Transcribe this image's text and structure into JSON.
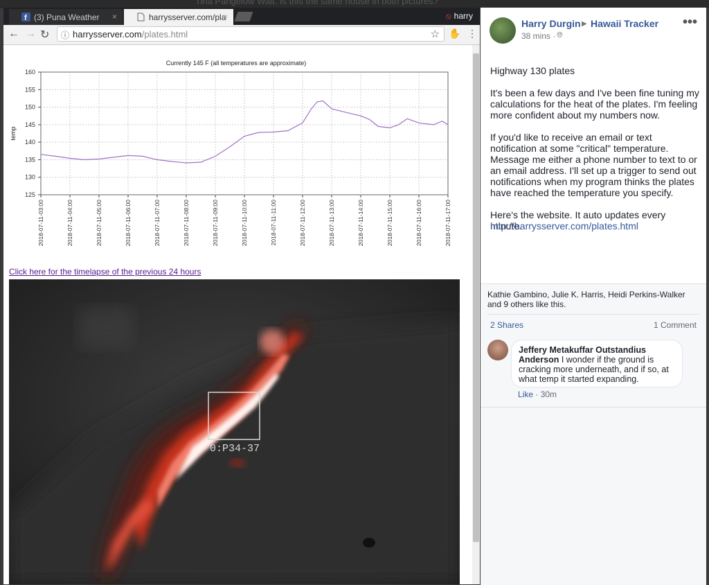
{
  "behind_text": "Tina Pangelow Wait. Is this the same house in both pictures?",
  "browser": {
    "tabs": [
      {
        "label": "(3) Puna Weather",
        "close": "×"
      },
      {
        "label": "harrysserver.com/pla",
        "close": "×"
      }
    ],
    "profile_name": "harry",
    "url_host": "harrysserver.com",
    "url_path": "/plates.html"
  },
  "page": {
    "timelapse_link": "Click here for the timelapse of the previous 24 hours"
  },
  "chart_data": {
    "type": "line",
    "title": "Currently 145 F (all temperatures are approximate)",
    "ylabel": "temp",
    "xlabel": "",
    "ylim": [
      125,
      160
    ],
    "yticks": [
      125,
      130,
      135,
      140,
      145,
      150,
      155,
      160
    ],
    "xticks": [
      "2018-07-11-03:00",
      "2018-07-11-04:00",
      "2018-07-11-05:00",
      "2018-07-11-06:00",
      "2018-07-11-07:00",
      "2018-07-11-08:00",
      "2018-07-11-09:00",
      "2018-07-11-10:00",
      "2018-07-11-11:00",
      "2018-07-11-12:00",
      "2018-07-11-13:00",
      "2018-07-11-14:00",
      "2018-07-11-15:00",
      "2018-07-11-16:00",
      "2018-07-11-17:00"
    ],
    "x_start_hour": 3,
    "x_end_hour": 17,
    "grid": true,
    "color": "#a070c8",
    "series": [
      {
        "x": [
          3.0,
          3.5,
          4.0,
          4.5,
          5.0,
          5.5,
          6.0,
          6.5,
          7.0,
          7.5,
          8.0,
          8.5,
          9.0,
          9.5,
          10.0,
          10.5,
          11.0,
          11.5,
          12.0,
          12.3,
          12.5,
          12.7,
          13.0,
          13.5,
          14.0,
          14.3,
          14.6,
          15.0,
          15.3,
          15.6,
          16.0,
          16.5,
          16.8,
          17.0
        ],
        "y": [
          136.5,
          136.0,
          135.4,
          135.0,
          135.2,
          135.7,
          136.2,
          136.0,
          135.0,
          134.5,
          134.1,
          134.3,
          136.0,
          138.7,
          141.7,
          142.8,
          142.9,
          143.3,
          145.5,
          149.5,
          151.5,
          151.8,
          149.5,
          148.5,
          147.5,
          146.5,
          144.5,
          144.1,
          145.0,
          146.7,
          145.5,
          145.0,
          146.0,
          145.0
        ]
      }
    ]
  },
  "thermal": {
    "label": "0:P34-37"
  },
  "facebook": {
    "author": "Harry Durgin",
    "group": "Hawaii Tracker",
    "time": "38 mins ·",
    "more": "•••",
    "paragraphs": [
      "Highway 130 plates",
      "It's been a few days and I've been fine tuning my calculations for the heat of the plates. I'm feeling more confident about my numbers now.",
      "If you'd like to receive an email or text notification at some \"critical\" temperature. Message me either a phone number to text to or an email address. I'll set up a trigger to send out notifications when my program thinks the plates have reached the temperature you specify.",
      "Here's the website. It auto updates every minute."
    ],
    "link": "http://harrysserver.com/plates.html",
    "likes": "Kathie Gambino, Julie K. Harris, Heidi Perkins-Walker and 9 others like this.",
    "shares": "2 Shares",
    "comments_count": "1 Comment",
    "comment": {
      "author": "Jeffery Metakuffar Outstandius Anderson",
      "text": "I wonder if the ground is cracking more underneath, and if so, at what temp it started expanding.",
      "like": "Like",
      "time": "· 30m"
    }
  }
}
